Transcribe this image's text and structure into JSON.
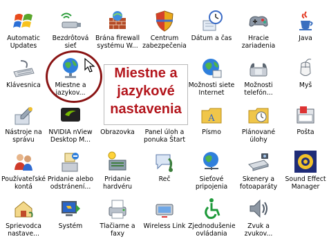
{
  "items": [
    {
      "l1": "Automatic",
      "l2": "Updates",
      "icon": "windows-flag-icon"
    },
    {
      "l1": "Bezdrôtová",
      "l2": "sieť",
      "icon": "wireless-usb-icon"
    },
    {
      "l1": "Brána firewall",
      "l2": "systému W...",
      "icon": "firewall-icon"
    },
    {
      "l1": "Centrum",
      "l2": "zabezpečenia",
      "icon": "security-shield-icon"
    },
    {
      "l1": "Dátum a čas",
      "l2": "",
      "icon": "clock-icon"
    },
    {
      "l1": "Hracie",
      "l2": "zariadenia",
      "icon": "gamepad-icon"
    },
    {
      "l1": "Java",
      "l2": "",
      "icon": "java-cup-icon"
    },
    {
      "l1": "Klávesnica",
      "l2": "",
      "icon": "keyboard-icon"
    },
    {
      "l1": "Miestne a",
      "l2": "jazykov...",
      "icon": "globe-icon"
    },
    {
      "l1": "",
      "l2": "",
      "icon": "none"
    },
    {
      "l1": "",
      "l2": "",
      "icon": "none"
    },
    {
      "l1": "Možnosti siete",
      "l2": "Internet",
      "icon": "internet-globe-icon"
    },
    {
      "l1": "Možnosti",
      "l2": "telefón...",
      "icon": "phone-icon"
    },
    {
      "l1": "Myš",
      "l2": "",
      "icon": "mouse-icon"
    },
    {
      "l1": "Nástroje na",
      "l2": "správu",
      "icon": "admin-tools-icon"
    },
    {
      "l1": "NVIDIA nView",
      "l2": "Desktop M...",
      "icon": "nvidia-icon"
    },
    {
      "l1": "Obrazovka",
      "l2": "",
      "icon": "display-icon"
    },
    {
      "l1": "Panel úloh a",
      "l2": "ponuka Štart",
      "icon": "taskbar-icon"
    },
    {
      "l1": "Písmo",
      "l2": "",
      "icon": "font-folder-icon"
    },
    {
      "l1": "Plánované",
      "l2": "úlohy",
      "icon": "scheduled-tasks-icon"
    },
    {
      "l1": "Pošta",
      "l2": "",
      "icon": "mail-icon"
    },
    {
      "l1": "Používateľské",
      "l2": "kontá",
      "icon": "users-icon"
    },
    {
      "l1": "Pridanie alebo",
      "l2": "odstránení...",
      "icon": "add-remove-icon"
    },
    {
      "l1": "Pridanie",
      "l2": "hardvéru",
      "icon": "add-hardware-icon"
    },
    {
      "l1": "Reč",
      "l2": "",
      "icon": "speech-icon"
    },
    {
      "l1": "Sieťové",
      "l2": "pripojenia",
      "icon": "network-icon"
    },
    {
      "l1": "Skenery a",
      "l2": "fotoaparáty",
      "icon": "scanner-icon"
    },
    {
      "l1": "Sound Effect",
      "l2": "Manager",
      "icon": "sound-effect-icon"
    },
    {
      "l1": "Sprievodca",
      "l2": "nastave...",
      "icon": "network-wizard-icon"
    },
    {
      "l1": "Systém",
      "l2": "",
      "icon": "system-icon"
    },
    {
      "l1": "Tlačiarne a",
      "l2": "faxy",
      "icon": "printer-icon"
    },
    {
      "l1": "Wireless Link",
      "l2": "",
      "icon": "wireless-link-icon"
    },
    {
      "l1": "Zjednodušenie",
      "l2": "ovládania",
      "icon": "accessibility-icon"
    },
    {
      "l1": "Zvuk a",
      "l2": "zvukov...",
      "icon": "speaker-icon"
    }
  ],
  "callout": {
    "line1": "Miestne a",
    "line2": "jazykové",
    "line3": "nastavenia",
    "color": "#b3151c"
  },
  "colors": {
    "ring": "#8a1414",
    "background": "#ffffff"
  }
}
